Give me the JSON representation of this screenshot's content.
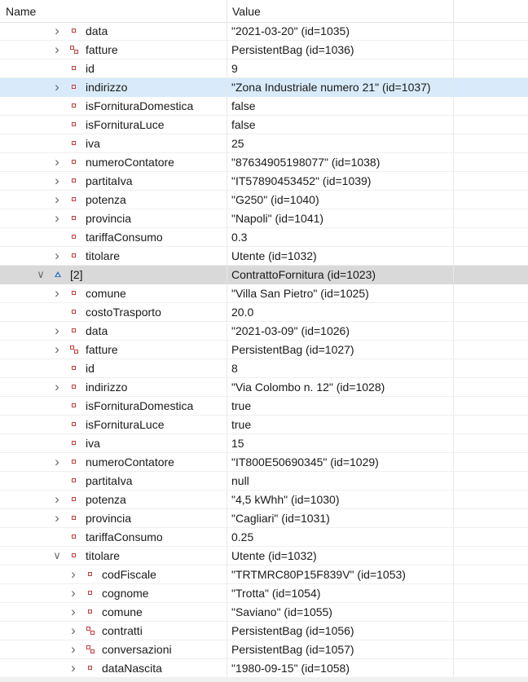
{
  "header": {
    "name": "Name",
    "value": "Value"
  },
  "rows": [
    {
      "name": "data",
      "value": "\"2021-03-20\" (id=1035)",
      "indent": 1,
      "arrow": "collapsed",
      "icon": "field"
    },
    {
      "name": "fatture",
      "value": "PersistentBag  (id=1036)",
      "indent": 1,
      "arrow": "collapsed",
      "icon": "collection"
    },
    {
      "name": "id",
      "value": "9",
      "indent": 1,
      "arrow": "none",
      "icon": "field"
    },
    {
      "name": "indirizzo",
      "value": "\"Zona Industriale numero 21\" (id=1037)",
      "indent": 1,
      "arrow": "collapsed",
      "icon": "field",
      "highlight": "blue"
    },
    {
      "name": "isFornituraDomestica",
      "value": "false",
      "indent": 1,
      "arrow": "none",
      "icon": "field"
    },
    {
      "name": "isFornituraLuce",
      "value": "false",
      "indent": 1,
      "arrow": "none",
      "icon": "field"
    },
    {
      "name": "iva",
      "value": "25",
      "indent": 1,
      "arrow": "none",
      "icon": "field"
    },
    {
      "name": "numeroContatore",
      "value": "\"87634905198077\" (id=1038)",
      "indent": 1,
      "arrow": "collapsed",
      "icon": "field"
    },
    {
      "name": "partitaIva",
      "value": "\"IT57890453452\" (id=1039)",
      "indent": 1,
      "arrow": "collapsed",
      "icon": "field"
    },
    {
      "name": "potenza",
      "value": "\"G250\" (id=1040)",
      "indent": 1,
      "arrow": "collapsed",
      "icon": "field"
    },
    {
      "name": "provincia",
      "value": "\"Napoli\" (id=1041)",
      "indent": 1,
      "arrow": "collapsed",
      "icon": "field"
    },
    {
      "name": "tariffaConsumo",
      "value": "0.3",
      "indent": 1,
      "arrow": "none",
      "icon": "field"
    },
    {
      "name": "titolare",
      "value": "Utente  (id=1032)",
      "indent": 1,
      "arrow": "collapsed",
      "icon": "field"
    },
    {
      "name": "[2]",
      "value": "ContrattoFornitura  (id=1023)",
      "indent": 0,
      "arrow": "expanded",
      "icon": "element",
      "highlight": "gray"
    },
    {
      "name": "comune",
      "value": "\"Villa San Pietro\" (id=1025)",
      "indent": 1,
      "arrow": "collapsed",
      "icon": "field"
    },
    {
      "name": "costoTrasporto",
      "value": "20.0",
      "indent": 1,
      "arrow": "none",
      "icon": "field"
    },
    {
      "name": "data",
      "value": "\"2021-03-09\" (id=1026)",
      "indent": 1,
      "arrow": "collapsed",
      "icon": "field"
    },
    {
      "name": "fatture",
      "value": "PersistentBag  (id=1027)",
      "indent": 1,
      "arrow": "collapsed",
      "icon": "collection"
    },
    {
      "name": "id",
      "value": "8",
      "indent": 1,
      "arrow": "none",
      "icon": "field"
    },
    {
      "name": "indirizzo",
      "value": "\"Via Colombo n. 12\" (id=1028)",
      "indent": 1,
      "arrow": "collapsed",
      "icon": "field"
    },
    {
      "name": "isFornituraDomestica",
      "value": "true",
      "indent": 1,
      "arrow": "none",
      "icon": "field"
    },
    {
      "name": "isFornituraLuce",
      "value": "true",
      "indent": 1,
      "arrow": "none",
      "icon": "field"
    },
    {
      "name": "iva",
      "value": "15",
      "indent": 1,
      "arrow": "none",
      "icon": "field"
    },
    {
      "name": "numeroContatore",
      "value": "\"IT800E50690345\" (id=1029)",
      "indent": 1,
      "arrow": "collapsed",
      "icon": "field"
    },
    {
      "name": "partitaIva",
      "value": "null",
      "indent": 1,
      "arrow": "none",
      "icon": "field"
    },
    {
      "name": "potenza",
      "value": "\"4,5 kWhh\" (id=1030)",
      "indent": 1,
      "arrow": "collapsed",
      "icon": "field"
    },
    {
      "name": "provincia",
      "value": "\"Cagliari\" (id=1031)",
      "indent": 1,
      "arrow": "collapsed",
      "icon": "field"
    },
    {
      "name": "tariffaConsumo",
      "value": "0.25",
      "indent": 1,
      "arrow": "none",
      "icon": "field"
    },
    {
      "name": "titolare",
      "value": "Utente  (id=1032)",
      "indent": 1,
      "arrow": "expanded",
      "icon": "field"
    },
    {
      "name": "codFiscale",
      "value": "\"TRTMRC80P15F839V\" (id=1053)",
      "indent": 2,
      "arrow": "collapsed",
      "icon": "field"
    },
    {
      "name": "cognome",
      "value": "\"Trotta\" (id=1054)",
      "indent": 2,
      "arrow": "collapsed",
      "icon": "field"
    },
    {
      "name": "comune",
      "value": "\"Saviano\" (id=1055)",
      "indent": 2,
      "arrow": "collapsed",
      "icon": "field"
    },
    {
      "name": "contratti",
      "value": "PersistentBag  (id=1056)",
      "indent": 2,
      "arrow": "collapsed",
      "icon": "collection"
    },
    {
      "name": "conversazioni",
      "value": "PersistentBag  (id=1057)",
      "indent": 2,
      "arrow": "collapsed",
      "icon": "collection"
    },
    {
      "name": "dataNascita",
      "value": "\"1980-09-15\" (id=1058)",
      "indent": 2,
      "arrow": "collapsed",
      "icon": "field"
    }
  ]
}
